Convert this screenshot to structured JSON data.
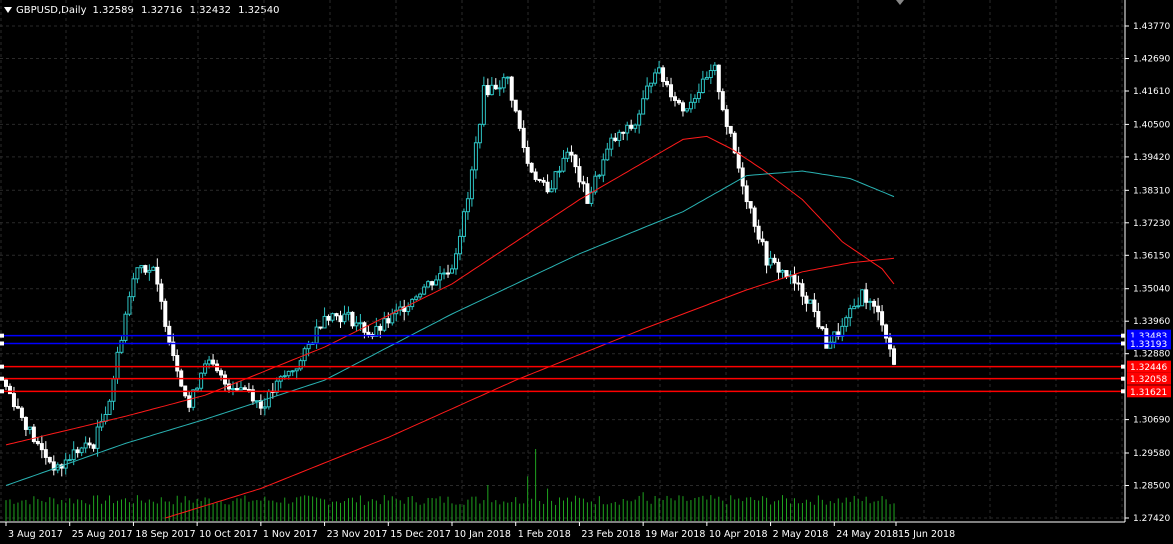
{
  "header": {
    "symbol_label": "GBPUSD,Daily",
    "open": "1.32589",
    "high": "1.32716",
    "low": "1.32432",
    "close": "1.32540"
  },
  "colors": {
    "background": "#000000",
    "grid": "#2a2a2a",
    "axis": "#ffffff",
    "candle_up": "#2ec4c4",
    "candle_down": "#ffffff",
    "ma_red": "#ff1a1a",
    "ma_teal": "#2ab3b3",
    "volume": "#1fa31f",
    "blue_line": "#0000ff",
    "red_line": "#ff0000"
  },
  "chart_data": {
    "type": "candlestick",
    "title": "",
    "xlabel": "",
    "ylabel": "",
    "ylim": [
      1.2742,
      1.4377
    ],
    "y_ticks": [
      "1.43770",
      "1.42690",
      "1.41610",
      "1.40500",
      "1.39420",
      "1.38310",
      "1.37230",
      "1.36150",
      "1.35040",
      "1.33960",
      "1.32880",
      "1.30690",
      "1.29580",
      "1.28500",
      "1.27420"
    ],
    "x_tick_labels": [
      "3 Aug 2017",
      "25 Aug 2017",
      "18 Sep 2017",
      "10 Oct 2017",
      "1 Nov 2017",
      "23 Nov 2017",
      "15 Dec 2017",
      "10 Jan 2018",
      "1 Feb 2018",
      "23 Feb 2018",
      "19 Mar 2018",
      "10 Apr 2018",
      "2 May 2018",
      "24 May 2018",
      "15 Jun 2018"
    ],
    "bars": 224,
    "x_tick_bar_index": [
      0,
      16,
      32,
      48,
      64,
      80,
      96,
      112,
      128,
      144,
      160,
      176,
      192,
      208,
      224
    ],
    "close_anchors": [
      [
        0,
        1.318
      ],
      [
        8,
        1.298
      ],
      [
        13,
        1.29
      ],
      [
        17,
        1.296
      ],
      [
        22,
        1.299
      ],
      [
        26,
        1.314
      ],
      [
        30,
        1.342
      ],
      [
        33,
        1.359
      ],
      [
        37,
        1.356
      ],
      [
        42,
        1.329
      ],
      [
        46,
        1.311
      ],
      [
        50,
        1.327
      ],
      [
        55,
        1.319
      ],
      [
        61,
        1.317
      ],
      [
        64,
        1.311
      ],
      [
        69,
        1.32
      ],
      [
        74,
        1.326
      ],
      [
        80,
        1.342
      ],
      [
        86,
        1.341
      ],
      [
        92,
        1.335
      ],
      [
        98,
        1.342
      ],
      [
        104,
        1.35
      ],
      [
        112,
        1.358
      ],
      [
        116,
        1.38
      ],
      [
        120,
        1.416
      ],
      [
        126,
        1.42
      ],
      [
        131,
        1.392
      ],
      [
        136,
        1.382
      ],
      [
        141,
        1.397
      ],
      [
        146,
        1.38
      ],
      [
        152,
        1.399
      ],
      [
        158,
        1.405
      ],
      [
        163,
        1.424
      ],
      [
        170,
        1.41
      ],
      [
        178,
        1.423
      ],
      [
        181,
        1.405
      ],
      [
        186,
        1.381
      ],
      [
        191,
        1.36
      ],
      [
        196,
        1.355
      ],
      [
        202,
        1.346
      ],
      [
        206,
        1.332
      ],
      [
        210,
        1.337
      ],
      [
        215,
        1.349
      ],
      [
        220,
        1.34
      ],
      [
        223,
        1.3254
      ]
    ],
    "volume_spikes": [
      [
        121,
        0.5
      ],
      [
        131,
        0.62
      ],
      [
        133,
        1.0
      ],
      [
        136,
        0.45
      ],
      [
        160,
        0.4
      ]
    ],
    "series": [
      {
        "color_key": "ma_red",
        "values": [
          [
            0,
            1.2985
          ],
          [
            30,
            1.308
          ],
          [
            50,
            1.315
          ],
          [
            80,
            1.331
          ],
          [
            112,
            1.352
          ],
          [
            144,
            1.38
          ],
          [
            170,
            1.4
          ],
          [
            176,
            1.401
          ],
          [
            182,
            1.397
          ],
          [
            190,
            1.39
          ],
          [
            200,
            1.38
          ],
          [
            210,
            1.366
          ],
          [
            220,
            1.357
          ],
          [
            223,
            1.352
          ]
        ]
      },
      {
        "color_key": "ma_teal",
        "values": [
          [
            0,
            1.285
          ],
          [
            30,
            1.299
          ],
          [
            50,
            1.307
          ],
          [
            80,
            1.32
          ],
          [
            112,
            1.342
          ],
          [
            144,
            1.362
          ],
          [
            170,
            1.376
          ],
          [
            186,
            1.388
          ],
          [
            200,
            1.3895
          ],
          [
            212,
            1.387
          ],
          [
            223,
            1.381
          ]
        ]
      },
      {
        "color_key": "ma_red",
        "values": [
          [
            40,
            1.2742
          ],
          [
            64,
            1.284
          ],
          [
            96,
            1.301
          ],
          [
            128,
            1.32
          ],
          [
            160,
            1.337
          ],
          [
            186,
            1.35
          ],
          [
            200,
            1.356
          ],
          [
            212,
            1.359
          ],
          [
            223,
            1.3605
          ]
        ]
      }
    ],
    "horizontal_lines": [
      {
        "color_key": "blue_line",
        "price": 1.3348,
        "label": "1.33483",
        "label_bg": "#0000ff"
      },
      {
        "color_key": "blue_line",
        "price": 1.3322,
        "label": "1.33193",
        "label_bg": "#0000ff"
      },
      {
        "color_key": "red_line",
        "price": 1.3245,
        "label": "1.32446",
        "label_bg": "#ff0000"
      },
      {
        "color_key": "red_line",
        "price": 1.3205,
        "label": "1.32058",
        "label_bg": "#ff0000"
      },
      {
        "color_key": "red_line",
        "price": 1.3163,
        "label": "1.31621",
        "label_bg": "#ff0000"
      }
    ]
  }
}
